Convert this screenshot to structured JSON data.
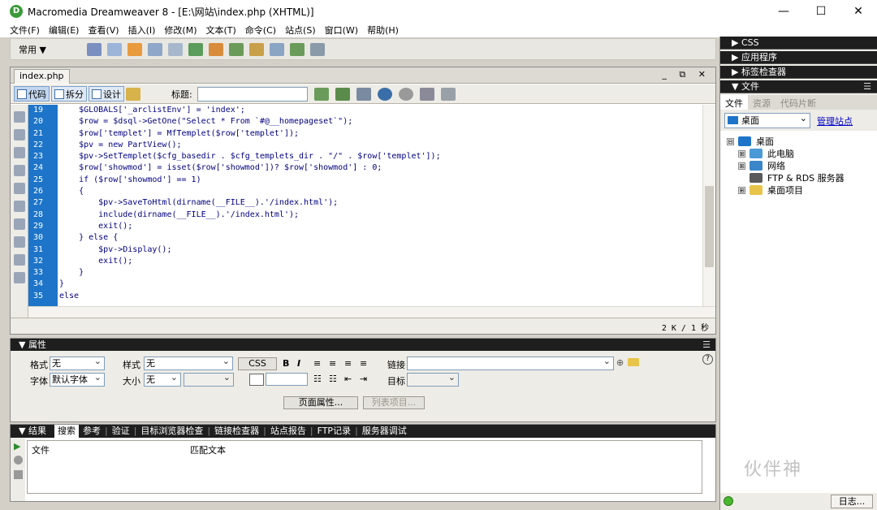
{
  "window": {
    "title": "Macromedia Dreamweaver 8 - [E:\\网站\\index.php (XHTML)]",
    "controls": [
      "—",
      "☐",
      "✕"
    ]
  },
  "menu": [
    "文件(F)",
    "编辑(E)",
    "查看(V)",
    "插入(I)",
    "修改(M)",
    "文本(T)",
    "命令(C)",
    "站点(S)",
    "窗口(W)",
    "帮助(H)"
  ],
  "insert_toolbar": {
    "category": "常用 ▼"
  },
  "document": {
    "tab": "index.php",
    "tab_controls": "_ ⧉ ✕",
    "views": {
      "code": "代码",
      "split": "拆分",
      "design": "设计"
    },
    "title_label": "标题:",
    "title_value": "",
    "status": "2 K / 1 秒",
    "line_numbers": [
      "19",
      "20",
      "21",
      "22",
      "23",
      "24",
      "25",
      "26",
      "27",
      "28",
      "29",
      "30",
      "31",
      "32",
      "33",
      "34",
      "35"
    ],
    "code_lines": [
      "    $GLOBALS['_arclistEnv'] = 'index';",
      "    $row = $dsql->GetOne(\"Select * From `#@__homepageset`\");",
      "    $row['templet'] = MfTemplet($row['templet']);",
      "    $pv = new PartView();",
      "    $pv->SetTemplet($cfg_basedir . $cfg_templets_dir . \"/\" . $row['templet']);",
      "    $row['showmod'] = isset($row['showmod'])? $row['showmod'] : 0;",
      "    if ($row['showmod'] == 1)",
      "    {",
      "        $pv->SaveToHtml(dirname(__FILE__).'/index.html');",
      "        include(dirname(__FILE__).'/index.html');",
      "        exit();",
      "    } else {",
      "        $pv->Display();",
      "        exit();",
      "    }",
      "}",
      "else"
    ]
  },
  "properties": {
    "header": "属性",
    "format_label": "格式",
    "format_value": "无",
    "style_label": "样式",
    "style_value": "无",
    "css_btn": "CSS",
    "bold": "B",
    "italic": "I",
    "link_label": "链接",
    "link_value": "",
    "font_label": "字体",
    "font_value": "默认字体",
    "size_label": "大小",
    "size_value": "无",
    "target_label": "目标",
    "page_props_btn": "页面属性...",
    "list_item_btn": "列表项目..."
  },
  "results": {
    "tabs": [
      "结果",
      "搜索",
      "参考",
      "验证",
      "目标浏览器检查",
      "链接检查器",
      "站点报告",
      "FTP记录",
      "服务器调试"
    ],
    "active_tab": "搜索",
    "col_file": "文件",
    "col_match": "匹配文本"
  },
  "right_panels": {
    "css": "CSS",
    "app": "应用程序",
    "tag": "标签检查器",
    "files": "文件",
    "file_tabs": [
      "文件",
      "资源",
      "代码片断"
    ],
    "site_select": "桌面",
    "manage_sites": "管理站点",
    "tree": [
      {
        "label": "桌面",
        "level": 0,
        "expander": "⊟"
      },
      {
        "label": "此电脑",
        "level": 1,
        "expander": "⊞"
      },
      {
        "label": "网络",
        "level": 1,
        "expander": "⊞"
      },
      {
        "label": "FTP & RDS 服务器",
        "level": 1,
        "expander": ""
      },
      {
        "label": "桌面项目",
        "level": 1,
        "expander": "⊞"
      }
    ],
    "log_btn": "日志..."
  },
  "watermark": "伙伴神",
  "colors": {
    "gutter": "#1d74c9",
    "panel_header": "#1e1e1e",
    "code_text": "#000080"
  }
}
